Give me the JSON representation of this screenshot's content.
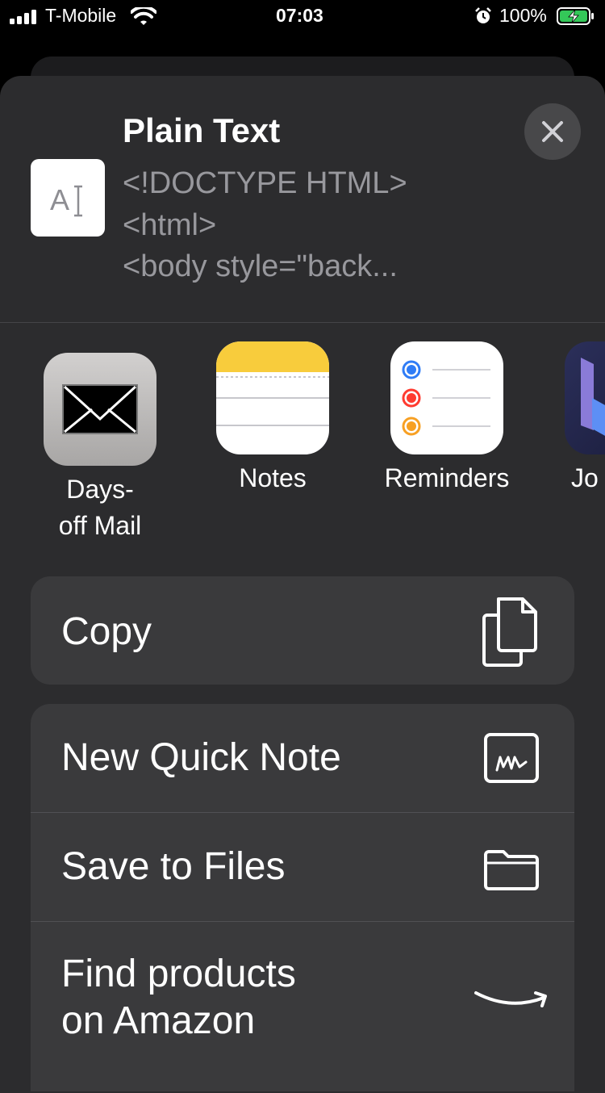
{
  "status_bar": {
    "carrier": "T-Mobile",
    "time": "07:03",
    "battery_percent": "100%"
  },
  "share_sheet": {
    "title": "Plain Text",
    "preview_lines": [
      "<!DOCTYPE HTML>",
      "<html>",
      "<body style=\"back..."
    ],
    "doc_icon_glyph": "A",
    "apps": [
      {
        "label_line1": "Days-",
        "label_line2": "off Mail",
        "icon": "mail-icon"
      },
      {
        "label_line1": "Notes",
        "icon": "notes-icon"
      },
      {
        "label_line1": "Reminders",
        "icon": "reminders-icon"
      },
      {
        "label_line1": "Jo",
        "icon": "partial-app-icon"
      }
    ],
    "actions_primary": [
      {
        "label": "Copy",
        "icon": "copy-icon"
      }
    ],
    "actions_secondary": [
      {
        "label": "New Quick Note",
        "icon": "quick-note-icon"
      },
      {
        "label": "Save to Files",
        "icon": "folder-icon"
      },
      {
        "label_line1": "Find products",
        "label_line2": "on Amazon",
        "icon": "amazon-smile-icon"
      }
    ]
  },
  "colors": {
    "sheet_bg": "#2c2c2e",
    "row_bg": "#3a3a3c",
    "accent_battery": "#34c759"
  }
}
